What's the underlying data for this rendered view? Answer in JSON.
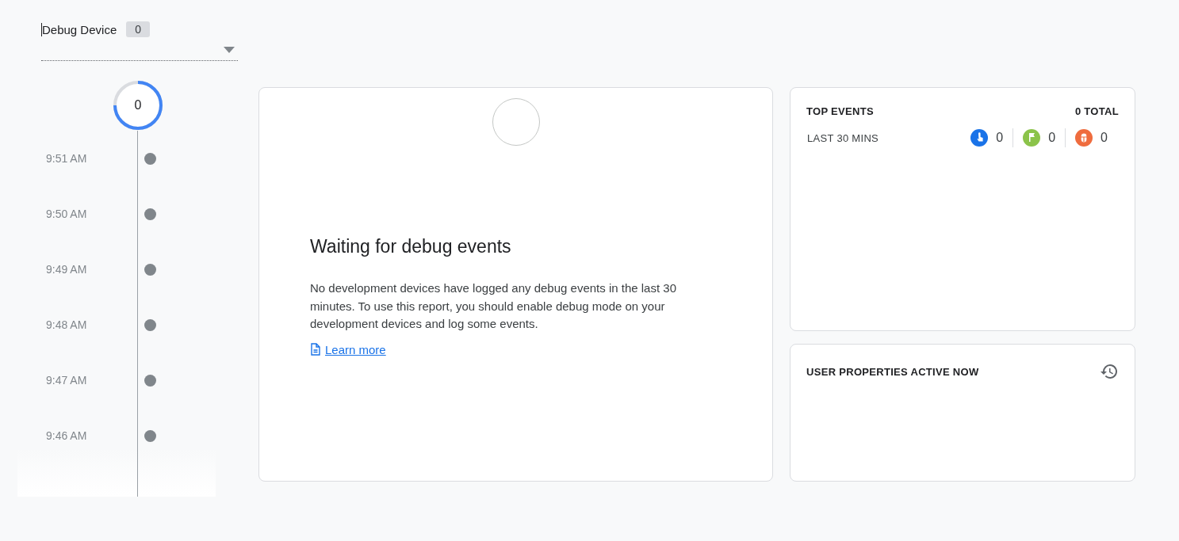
{
  "device_selector": {
    "label": "Debug Device",
    "count": "0"
  },
  "timeline": {
    "counter": "0",
    "times": [
      "9:51 AM",
      "9:50 AM",
      "9:49 AM",
      "9:48 AM",
      "9:47 AM",
      "9:46 AM"
    ]
  },
  "empty_state": {
    "title": "Waiting for debug events",
    "message": "No development devices have logged any debug events in the last 30 minutes. To use this report, you should enable debug mode on your development devices and log some events.",
    "link": "Learn more"
  },
  "top_events": {
    "title": "TOP EVENTS",
    "total": "0 TOTAL",
    "period": "LAST 30 MINS",
    "counts": [
      {
        "kind": "touch",
        "color": "#1a73e8",
        "value": "0"
      },
      {
        "kind": "flag",
        "color": "#8bc34a",
        "value": "0"
      },
      {
        "kind": "bug",
        "color": "#ef6c3e",
        "value": "0"
      }
    ]
  },
  "user_properties": {
    "title": "USER PROPERTIES ACTIVE NOW"
  }
}
